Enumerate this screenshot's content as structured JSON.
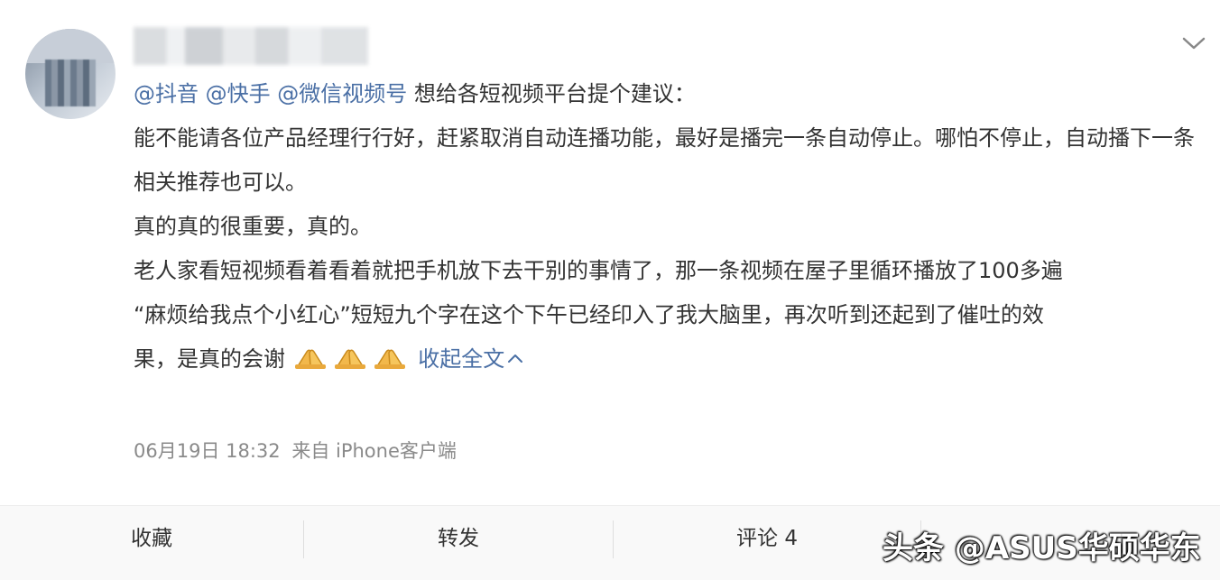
{
  "post": {
    "mentions": [
      "@抖音",
      "@快手",
      "@微信视频号"
    ],
    "intro": "想给各短视频平台提个建议：",
    "paragraphs": [
      "能不能请各位产品经理行行好，赶紧取消自动连播功能，最好是播完一条自动停止。哪怕不停止，自动播下一条相关推荐也可以。",
      "真的真的很重要，真的。",
      "老人家看短视频看着看着就把手机放下去干别的事情了，那一条视频在屋子里循环播放了100多遍",
      "“麻烦给我点个小红心”短短九个字在这个下午已经印入了我大脑里，再次听到还起到了催吐的效"
    ],
    "last_line": "果，是真的会谢",
    "emoji": [
      "folded-hands-emoji",
      "folded-hands-emoji",
      "folded-hands-emoji"
    ],
    "collapse_label": "收起全文",
    "timestamp": "06月19日 18:32",
    "source": "来自 iPhone客户端"
  },
  "actions": {
    "favorite": "收藏",
    "repost": "转发",
    "comment": "评论 4"
  },
  "watermark": "头条 @ASUS华硕华东",
  "colors": {
    "link": "#4a6fa5",
    "meta": "#8a8a8a",
    "text": "#333333"
  }
}
